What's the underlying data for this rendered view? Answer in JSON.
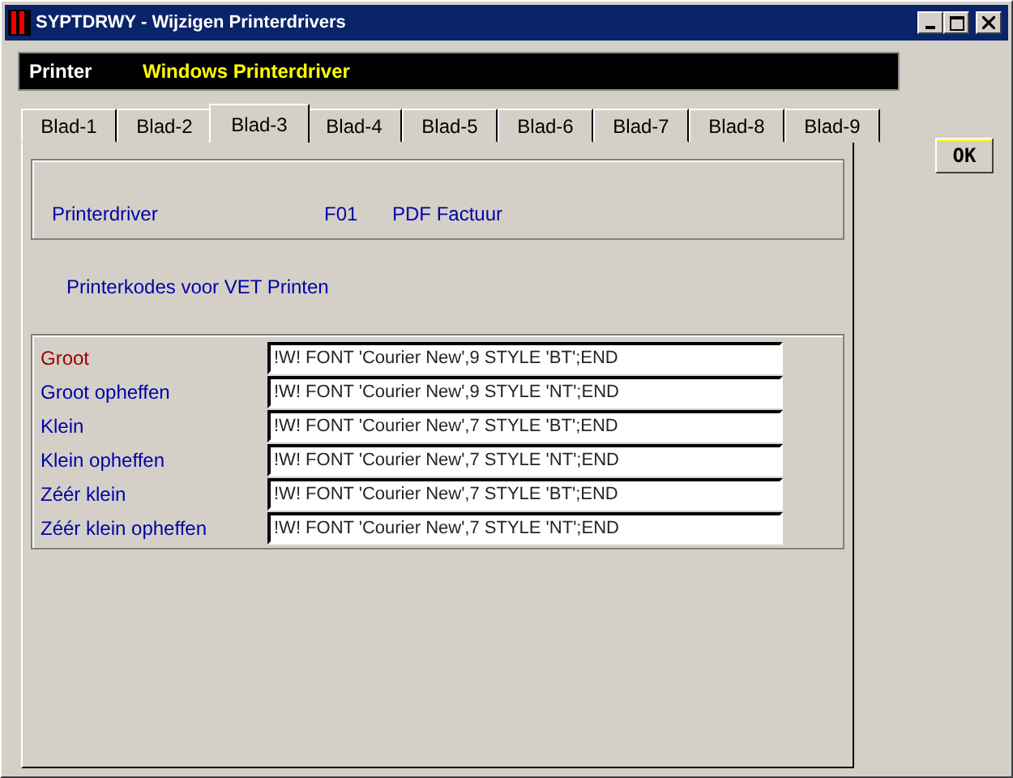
{
  "window": {
    "title": "SYPTDRWY - Wijzigen Printerdrivers"
  },
  "header": {
    "label": "Printer",
    "value": "Windows Printerdriver"
  },
  "tabs": [
    {
      "label": "Blad-1",
      "selected": false
    },
    {
      "label": "Blad-2",
      "selected": false
    },
    {
      "label": "Blad-3",
      "selected": true
    },
    {
      "label": "Blad-4",
      "selected": false
    },
    {
      "label": "Blad-5",
      "selected": false
    },
    {
      "label": "Blad-6",
      "selected": false
    },
    {
      "label": "Blad-7",
      "selected": false
    },
    {
      "label": "Blad-8",
      "selected": false
    },
    {
      "label": "Blad-9",
      "selected": false
    }
  ],
  "driver": {
    "label": "Printerdriver",
    "code": "F01",
    "name": "PDF Factuur"
  },
  "section_title": "Printerkodes voor VET Printen",
  "fields": [
    {
      "label": "Groot",
      "value": "!W! FONT 'Courier New',9 STYLE 'BT';END",
      "selected": true
    },
    {
      "label": "Groot opheffen",
      "value": "!W! FONT 'Courier New',9 STYLE 'NT';END",
      "selected": false
    },
    {
      "label": "Klein",
      "value": "!W! FONT 'Courier New',7 STYLE 'BT';END",
      "selected": false
    },
    {
      "label": "Klein opheffen",
      "value": "!W! FONT 'Courier New',7 STYLE 'NT';END",
      "selected": false
    },
    {
      "label": "Zéér klein",
      "value": "!W! FONT 'Courier New',7 STYLE 'BT';END",
      "selected": false
    },
    {
      "label": "Zéér klein opheffen",
      "value": "!W! FONT 'Courier New',7 STYLE 'NT';END",
      "selected": false
    }
  ],
  "ok_button": "OK"
}
